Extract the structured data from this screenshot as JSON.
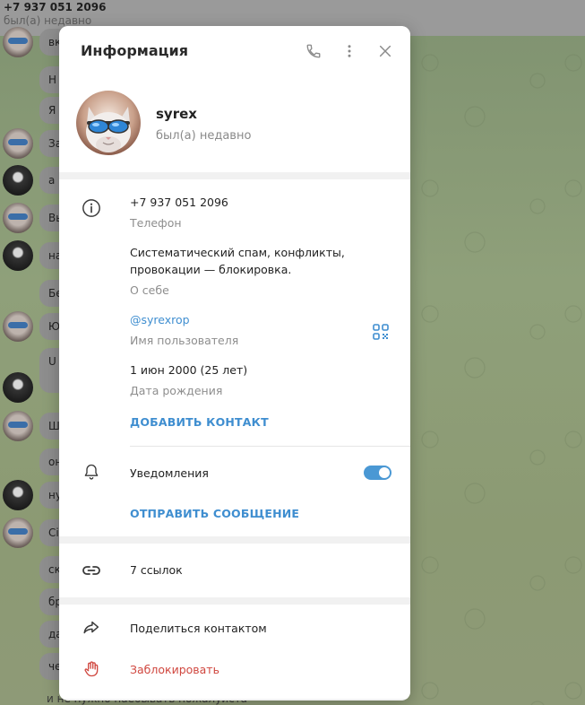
{
  "background_chat": {
    "header_phone": "+7 937 051 2096",
    "header_status": "был(а) недавно",
    "bubbles": [
      "вк",
      "Н",
      "Я",
      "За",
      "а",
      "Вы",
      "на",
      "Бе",
      "Ю",
      "U",
      "Ш",
      "он",
      "ну",
      "Сі",
      "ск",
      "бр",
      "да",
      "че"
    ],
    "bottom_message": "и не нужно наебывать пожалуйста"
  },
  "modal": {
    "title": "Информация",
    "profile": {
      "name": "syrex",
      "status": "был(а) недавно"
    },
    "info": {
      "phone": "+7 937 051 2096",
      "phone_label": "Телефон",
      "bio_line1": "Систематический спам, конфликты,",
      "bio_line2": "провокации — блокировка.",
      "bio_label": "О себе",
      "username": "@syrexrop",
      "username_label": "Имя пользователя",
      "birthday": "1 июн 2000 (25 лет)",
      "birthday_label": "Дата рождения",
      "add_contact": "ДОБАВИТЬ КОНТАКТ",
      "notifications": "Уведомления",
      "notifications_on": true,
      "send_message": "ОТПРАВИТЬ СООБЩЕНИЕ"
    },
    "links": {
      "count_label": "7 ссылок"
    },
    "actions": {
      "share": "Поделиться контактом",
      "block": "Заблокировать"
    }
  },
  "colors": {
    "accent": "#3f8ed0",
    "danger": "#d0473f",
    "toggle_on": "#4a98d4"
  },
  "icons": {
    "call": "phone-icon",
    "more": "more-vertical-icon",
    "close": "close-icon",
    "info": "info-icon",
    "qr": "qr-code-icon",
    "bell": "bell-icon",
    "link": "link-icon",
    "share": "share-arrow-icon",
    "block": "hand-stop-icon"
  }
}
